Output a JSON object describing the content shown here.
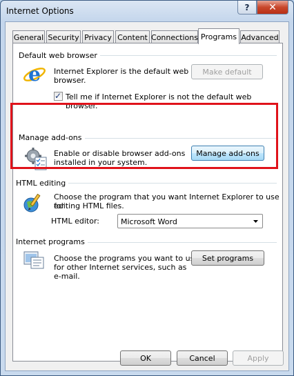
{
  "window": {
    "title": "Internet Options",
    "help_glyph": "?",
    "close_glyph": "✕"
  },
  "tabs": [
    {
      "label": "General"
    },
    {
      "label": "Security"
    },
    {
      "label": "Privacy"
    },
    {
      "label": "Content"
    },
    {
      "label": "Connections"
    },
    {
      "label": "Programs",
      "active": true
    },
    {
      "label": "Advanced"
    }
  ],
  "default_browser": {
    "title": "Default web browser",
    "status_line1": "Internet Explorer is the default web",
    "status_line2": "browser.",
    "make_default_label": "Make default",
    "checkbox_label": "Tell me if Internet Explorer is not the default web browser.",
    "checkbox_checked": true,
    "check_glyph": "✓",
    "icon": "internet-explorer-icon"
  },
  "manage_addons": {
    "title": "Manage add-ons",
    "desc_line1": "Enable or disable browser add-ons",
    "desc_line2": "installed in your system.",
    "button_label": "Manage add-ons",
    "icon": "addons-gear-icon"
  },
  "html_editing": {
    "title": "HTML editing",
    "desc_line1": "Choose the program that you want Internet Explorer to use for",
    "desc_line2": "editing HTML files.",
    "editor_label": "HTML editor:",
    "editor_value": "Microsoft Word",
    "icon": "html-editor-icon"
  },
  "internet_programs": {
    "title": "Internet programs",
    "desc_line1": "Choose the programs you want to use",
    "desc_line2": "for other Internet services, such as",
    "desc_line3": "e-mail.",
    "button_label": "Set programs",
    "icon": "internet-programs-icon"
  },
  "footer": {
    "ok_label": "OK",
    "cancel_label": "Cancel",
    "apply_label": "Apply"
  },
  "colors": {
    "highlight": "#e0121a",
    "title_close": "#c8472b",
    "focused_button": "#3c7fb1"
  }
}
